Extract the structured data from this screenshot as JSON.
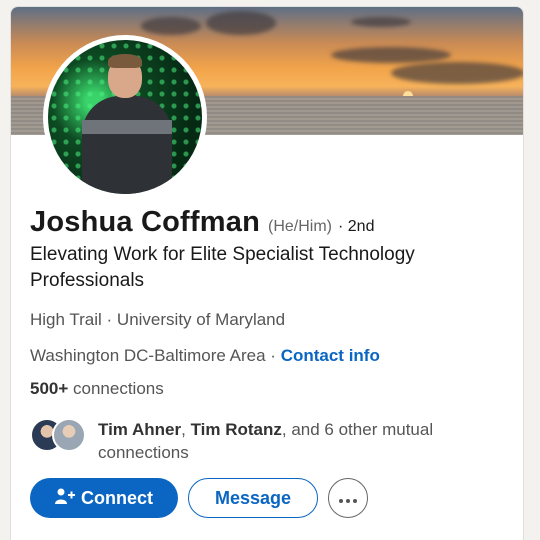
{
  "profile": {
    "name": "Joshua Coffman",
    "pronouns": "(He/Him)",
    "degree": "· 2nd",
    "headline": "Elevating Work for Elite Specialist Technology Professionals",
    "company": "High Trail",
    "separator": " · ",
    "education": "University of Maryland",
    "location": "Washington DC-Baltimore Area",
    "location_separator": " · ",
    "contact_info": "Contact info",
    "connections_count": "500+",
    "connections_label": " connections"
  },
  "mutual": {
    "name1": "Tim Ahner",
    "comma": ", ",
    "name2": "Tim Rotanz",
    "rest": ", and 6 other mutual connections"
  },
  "actions": {
    "connect_label": "Connect",
    "message_label": "Message"
  },
  "icons": {
    "connect": "add-person-icon",
    "more": "more-horizontal-icon"
  },
  "colors": {
    "accent": "#0a66c2",
    "text_primary": "#191919",
    "text_secondary": "#555555"
  }
}
